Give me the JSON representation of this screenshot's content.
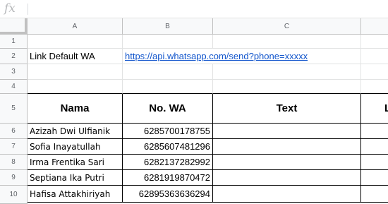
{
  "formula_bar": {
    "fx_label": "fx",
    "value": ""
  },
  "columns": [
    "A",
    "B",
    "C"
  ],
  "rows": [
    "1",
    "2",
    "3",
    "4",
    "5",
    "6",
    "7",
    "8",
    "9",
    "10"
  ],
  "link_row": {
    "label": "Link Default WA",
    "url": "https://api.whatsapp.com/send?phone=xxxxx"
  },
  "table": {
    "headers": [
      "Nama",
      "No. WA",
      "Text",
      "L"
    ],
    "records": [
      {
        "nama": "Azizah Dwi Ulfianik",
        "no_wa": "6285700178755"
      },
      {
        "nama": "Sofia Inayatullah",
        "no_wa": "6285607481296"
      },
      {
        "nama": "Irma Frentika Sari",
        "no_wa": "6282137282992"
      },
      {
        "nama": "Septiana Ika Putri",
        "no_wa": "6281919870472"
      },
      {
        "nama": "Hafisa Attakhiriyah",
        "no_wa": "62895363636294"
      }
    ]
  }
}
